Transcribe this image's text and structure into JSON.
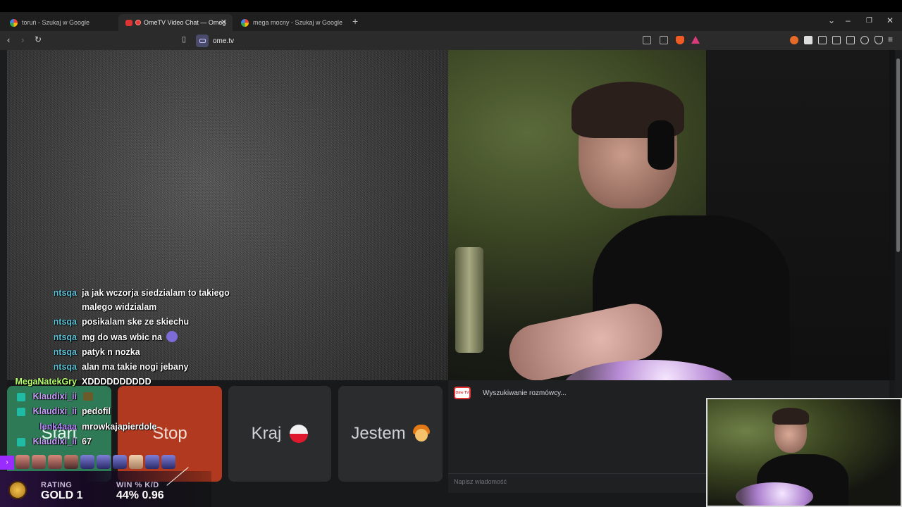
{
  "browser": {
    "tabs": [
      {
        "title": "toruń - Szukaj w Google",
        "active": false
      },
      {
        "title": "OmeTV Video Chat — Omeg",
        "active": true
      },
      {
        "title": "mega mocny - Szukaj w Google",
        "active": false
      }
    ],
    "new_tab": "+",
    "url": "ome.tv"
  },
  "ome": {
    "buttons": {
      "start": "Start",
      "stop": "Stop",
      "country": "Kraj",
      "gender": "Jestem"
    },
    "searching": "Wyszukiwanie rozmówcy...",
    "message_placeholder": "Napisz wiadomość",
    "logo_text": "Ome TV"
  },
  "stream_chat": [
    {
      "user": "ntsqa",
      "text": "ja jak wczorja siedzialam to takiego"
    },
    {
      "user": "",
      "text": "malego widzialam"
    },
    {
      "user": "ntsqa",
      "text": "posikalam ske ze skiechu"
    },
    {
      "user": "ntsqa",
      "text": "mg do was wbic na"
    },
    {
      "user": "ntsqa",
      "text": "patyk n nozka"
    },
    {
      "user": "ntsqa",
      "text": "alan ma takie nogi jebany"
    },
    {
      "user": "MegaNatekGry",
      "text": "XDDDDDDDDDD"
    },
    {
      "user": "Klaudixi_ii",
      "text": ""
    },
    {
      "user": "Klaudixi_ii",
      "text": "pedofil"
    },
    {
      "user": "lenk4aaa",
      "text": "mrowkajapierdole"
    },
    {
      "user": "Klaudixi_ii",
      "text": "67"
    }
  ],
  "game_stats": {
    "rating_label": "RATING",
    "rating_value": "GOLD 1",
    "win_label": "WIN % K/D",
    "win_value": "44% 0.96"
  },
  "colors": {
    "start_green": "#2f7a56",
    "stop_red": "#b0391f",
    "panel_gray": "#2a2c2e"
  }
}
